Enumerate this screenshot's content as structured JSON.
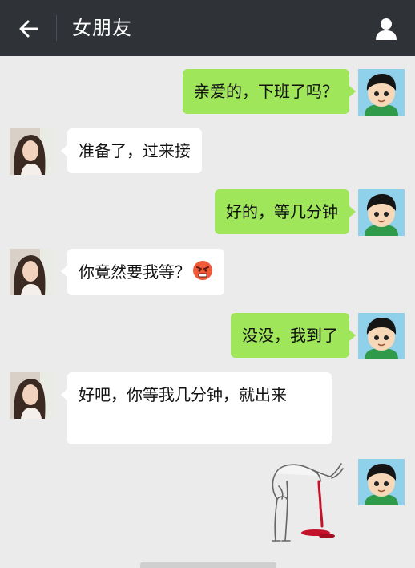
{
  "header": {
    "title": "女朋友",
    "back_icon": "arrow-left-icon",
    "profile_icon": "person-icon"
  },
  "colors": {
    "header_bg": "#2f3338",
    "chat_bg": "#ebebeb",
    "outgoing_bubble": "#9fe65a",
    "incoming_bubble": "#ffffff"
  },
  "messages": [
    {
      "sender": "me",
      "text": "亲爱的，下班了吗？"
    },
    {
      "sender": "her",
      "text": "准备了，过来接"
    },
    {
      "sender": "me",
      "text": "好的，等几分钟"
    },
    {
      "sender": "her",
      "text": "你竟然要我等？",
      "emoji": "angry-face-icon"
    },
    {
      "sender": "me",
      "text": "没没，我到了"
    },
    {
      "sender": "her",
      "text": "好吧，你等我几分钟，就出来"
    },
    {
      "sender": "me",
      "sticker": "vomiting-blood-sticker"
    }
  ]
}
